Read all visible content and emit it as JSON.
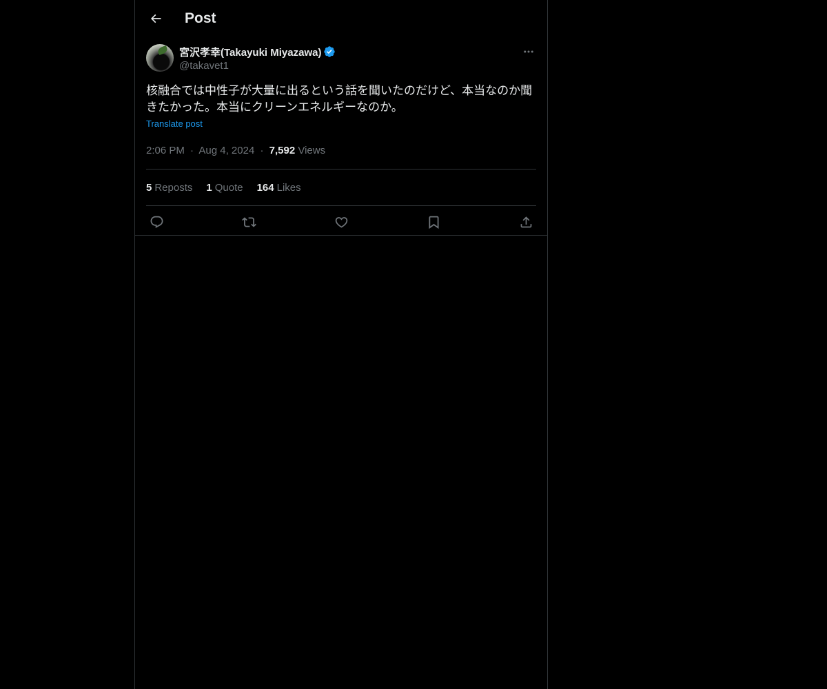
{
  "header": {
    "title": "Post",
    "back_icon": "arrow-left-icon"
  },
  "post": {
    "author": {
      "display_name": "宮沢孝幸(Takayuki Miyazawa)",
      "handle": "@takavet1",
      "verified": true
    },
    "text": "核融合では中性子が大量に出るという話を聞いたのだけど、本当なのか聞きたかった。本当にクリーンエネルギーなのか。",
    "translate_label": "Translate post",
    "time": "2:06 PM",
    "date": "Aug 4, 2024",
    "separator": "·",
    "views_count": "7,592",
    "views_label": "Views",
    "stats": {
      "reposts_count": "5",
      "reposts_label": "Reposts",
      "quotes_count": "1",
      "quotes_label": "Quote",
      "likes_count": "164",
      "likes_label": "Likes"
    },
    "actions": [
      "reply-icon",
      "repost-icon",
      "like-icon",
      "bookmark-icon",
      "share-icon"
    ]
  },
  "colors": {
    "background": "#000000",
    "text_primary": "#e7e9ea",
    "text_secondary": "#71767b",
    "accent": "#1d9bf0",
    "border": "#2f3336"
  }
}
